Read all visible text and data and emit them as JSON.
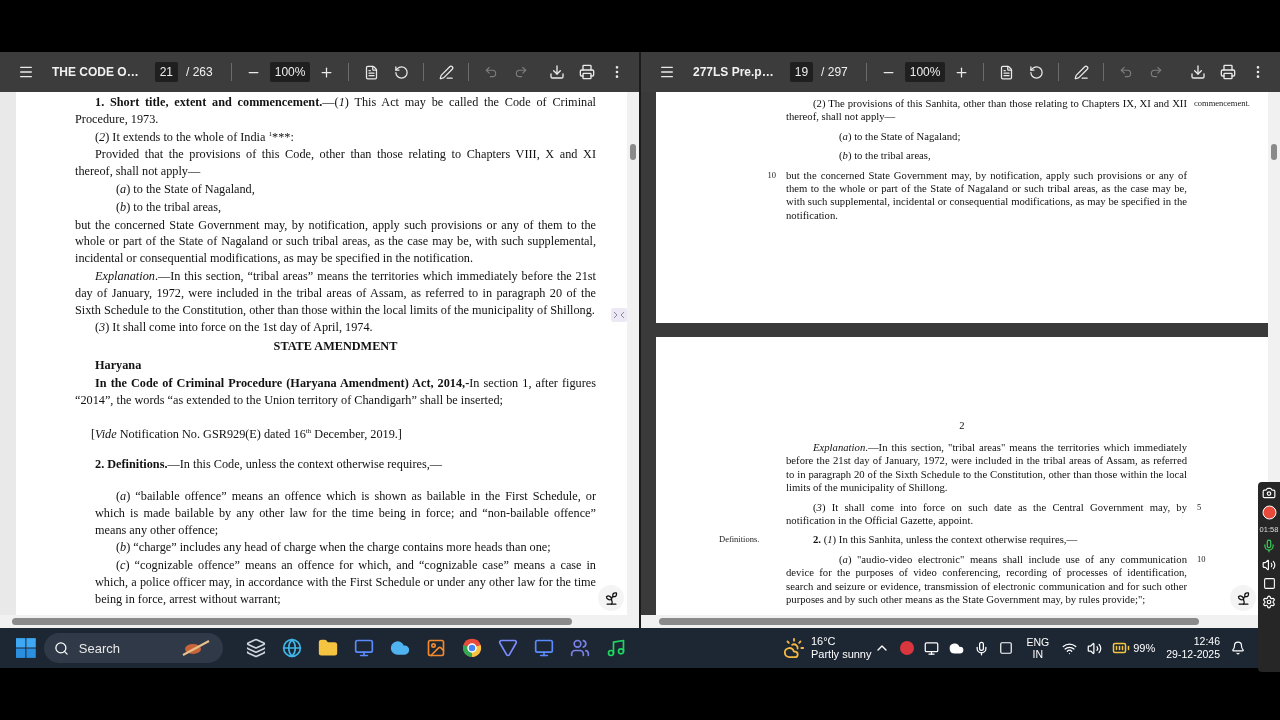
{
  "viewers": [
    {
      "toolbar": {
        "title": "THE CODE O…",
        "page": "21",
        "page_count": "/ 263",
        "zoom": "100%",
        "undo_available": false
      },
      "pages": [
        {
          "kind": "plain",
          "blocks": [
            {
              "kind": "para",
              "text": "**1. Short title, extent and commencement.**—(*1*) This Act may be called the Code of Criminal Procedure, 1973."
            },
            {
              "kind": "para",
              "text": "(*2*) It extends to the whole of India $^{1}$***:"
            },
            {
              "kind": "para",
              "text": "Provided that the provisions of this Code, other than those relating to Chapters VIII, X and XI thereof, shall not apply—"
            },
            {
              "kind": "item",
              "text": "(*a*) to the State of Nagaland,"
            },
            {
              "kind": "item",
              "text": "(*b*) to the tribal areas,"
            },
            {
              "kind": "flush",
              "text": "but the concerned State Government may, by notification, apply such provisions or any of them to the whole or part of the State of Nagaland or such tribal areas, as the case may be, with such supplemental, incidental or consequential modifications, as may be specified in the notification."
            },
            {
              "kind": "para",
              "text": "*Explanation*.—In this section, “tribal areas” means the territories which immediately before the 21st day of January, 1972, were included in the tribal areas of Assam, as referred to in paragraph 20 of the Sixth Schedule to the Constitution, other than those within the local limits of the municipality of Shillong."
            },
            {
              "kind": "para",
              "text": "(*3*) It shall come into force on the 1st day of April, 1974."
            },
            {
              "kind": "heading",
              "text": "STATE AMENDMENT"
            },
            {
              "kind": "subheading",
              "text": "Haryana"
            },
            {
              "kind": "para",
              "text": "**In the Code of Criminal Procedure (Haryana Amendment) Act, 2014,-**In section 1, after figures “2014”, the words “as extended to the Union territory of Chandigarh” shall be inserted;"
            },
            {
              "kind": "note",
              "text": "[*Vide* Notification No. GSR929(E) dated 16$^{th}$ December, 2019.]"
            },
            {
              "kind": "para",
              "text": "**2. Definitions.**—In this Code, unless the context otherwise requires,—"
            },
            {
              "kind": "sub",
              "text": "(*a*) “bailable offence” means an offence which is shown as bailable in the First Schedule, or which is made bailable by any other law for the time being in force; and “non-bailable offence” means any other offence;"
            },
            {
              "kind": "sub",
              "text": "(*b*) “charge” includes any head of charge when the charge contains more heads than one;"
            },
            {
              "kind": "sub",
              "text": "(*c*) “cognizable offence” means an offence for which, and “cognizable case” means a case in which, a police officer may, in accordance with the First Schedule or under any other law for the time being in force, arrest without warrant;"
            }
          ]
        }
      ]
    },
    {
      "toolbar": {
        "title": "277LS Pre.p…",
        "page": "19",
        "page_count": "/ 297",
        "zoom": "100%",
        "undo_available": false
      },
      "pages": [
        {
          "kind": "odd",
          "blocks": [
            {
              "kind": "para",
              "text": "(2) The provisions of this Sanhita, other than those relating to Chapters IX, XI and XII thereof, shall not apply—",
              "margin_note": "commencement."
            },
            {
              "kind": "item",
              "text": "(*a*) to the State of Nagaland;"
            },
            {
              "kind": "item",
              "text": "(*b*) to the tribal areas,"
            },
            {
              "kind": "flush",
              "text": "but the concerned State Government may, by notification, apply such provisions or any of them to the whole or part of the State of Nagaland or such tribal areas, as the case may be, with such supplemental, incidental or consequential modifications, as may be specified in the notification.",
              "line_number": "10"
            }
          ]
        },
        {
          "kind": "even",
          "page_number": "2",
          "blocks": [
            {
              "kind": "para",
              "text": "*Explanation*.—In this section, \"tribal areas\" means the territories which immediately before the 21st day of January, 1972, were included in the tribal areas of Assam, as referred to in paragraph 20 of the Sixth Schedule to the Constitution, other than those within the local limits of the municipality of Shillong."
            },
            {
              "kind": "para",
              "text": "(*3*) It shall come into force on such date as the Central Government may, by notification in the Official Gazette, appoint.",
              "line_number": "5"
            },
            {
              "kind": "para",
              "text": "**2.** (*1*) In this Sanhita, unless the context otherwise requires,—",
              "margin_note": "Definitions."
            },
            {
              "kind": "item",
              "text": "(*a*) \"audio-video electronic\" means shall include use of any communication device for the purposes of video conferencing, recording of processes of identification, search and seizure or evidence, transmission of electronic communication and for such other purposes and by such other means as the State Government may, by rules provide;\";",
              "line_number": "10"
            }
          ]
        }
      ]
    }
  ],
  "taskbar": {
    "search": {
      "placeholder": "Search"
    },
    "weather": {
      "temperature": "16°C",
      "condition": "Partly sunny"
    },
    "language": {
      "code": "ENG",
      "region": "IN"
    },
    "battery": "99%",
    "time": "12:46",
    "date": "29-12-2025"
  },
  "recorder": {
    "timer": "01:58"
  }
}
